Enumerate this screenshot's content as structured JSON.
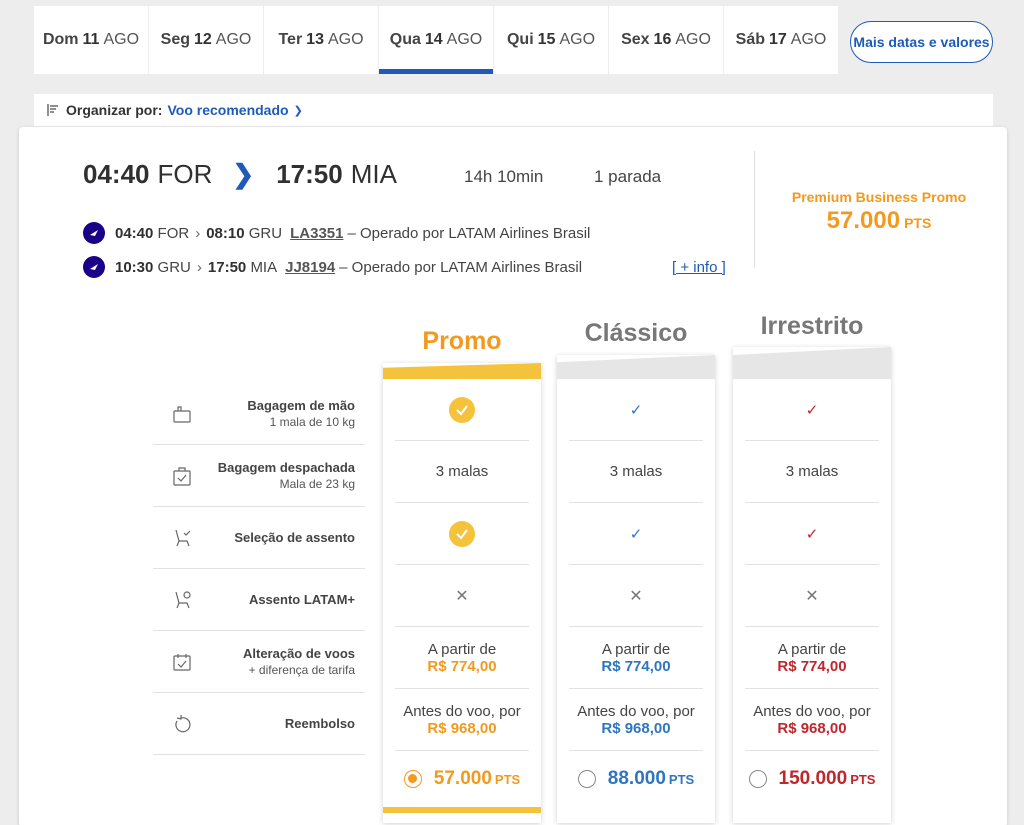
{
  "date_tabs": [
    {
      "day": "Dom",
      "num": "11",
      "month": "AGO"
    },
    {
      "day": "Seg",
      "num": "12",
      "month": "AGO"
    },
    {
      "day": "Ter",
      "num": "13",
      "month": "AGO"
    },
    {
      "day": "Qua",
      "num": "14",
      "month": "AGO"
    },
    {
      "day": "Qui",
      "num": "15",
      "month": "AGO"
    },
    {
      "day": "Sex",
      "num": "16",
      "month": "AGO"
    },
    {
      "day": "Sáb",
      "num": "17",
      "month": "AGO"
    }
  ],
  "more_dates_label": "Mais datas e valores",
  "sort": {
    "label": "Organizar por:",
    "value": "Voo recomendado"
  },
  "flight": {
    "dep_time": "04:40",
    "dep_code": "FOR",
    "arr_time": "17:50",
    "arr_code": "MIA",
    "duration": "14h 10min",
    "stops": "1 parada",
    "segments": [
      {
        "dep_time": "04:40",
        "dep_code": "FOR",
        "arr_time": "08:10",
        "arr_code": "GRU",
        "flight_no": "LA3351",
        "operator": "– Operado por LATAM Airlines Brasil"
      },
      {
        "dep_time": "10:30",
        "dep_code": "GRU",
        "arr_time": "17:50",
        "arr_code": "MIA",
        "flight_no": "JJ8194",
        "operator": "– Operado por LATAM Airlines Brasil"
      }
    ],
    "more_info": "[ + info ]"
  },
  "premium": {
    "name": "Premium Business Promo",
    "points": "57.000",
    "unit": "PTS"
  },
  "features": [
    {
      "title": "Bagagem de mão",
      "sub": "1 mala de 10 kg"
    },
    {
      "title": "Bagagem despachada",
      "sub": "Mala de 23 kg"
    },
    {
      "title": "Seleção de assento",
      "sub": ""
    },
    {
      "title": "Assento LATAM+",
      "sub": ""
    },
    {
      "title": "Alteração de voos",
      "sub": "+ diferença de tarifa"
    },
    {
      "title": "Reembolso",
      "sub": ""
    }
  ],
  "fares": [
    {
      "name": "Promo",
      "bags": "3 malas",
      "change_text": "A partir de",
      "change_price": "R$ 774,00",
      "refund_text": "Antes do voo, por",
      "refund_price": "R$ 968,00",
      "points": "57.000",
      "unit": "PTS",
      "color": "#f29a1f"
    },
    {
      "name": "Clássico",
      "bags": "3 malas",
      "change_text": "A partir de",
      "change_price": "R$ 774,00",
      "refund_text": "Antes do voo, por",
      "refund_price": "R$ 968,00",
      "points": "88.000",
      "unit": "PTS",
      "color": "#2f76c0"
    },
    {
      "name": "Irrestrito",
      "bags": "3 malas",
      "change_text": "A partir de",
      "change_price": "R$ 774,00",
      "refund_text": "Antes do voo, por",
      "refund_price": "R$ 968,00",
      "points": "150.000",
      "unit": "PTS",
      "color": "#c0272d"
    }
  ],
  "colors": {
    "primary": "#1d5bb7",
    "promo": "#f29a1f",
    "promo_band": "#f5c33b",
    "classico": "#2f76c0",
    "irrestrito": "#c0272d",
    "band_grey": "#e6e6e6"
  }
}
